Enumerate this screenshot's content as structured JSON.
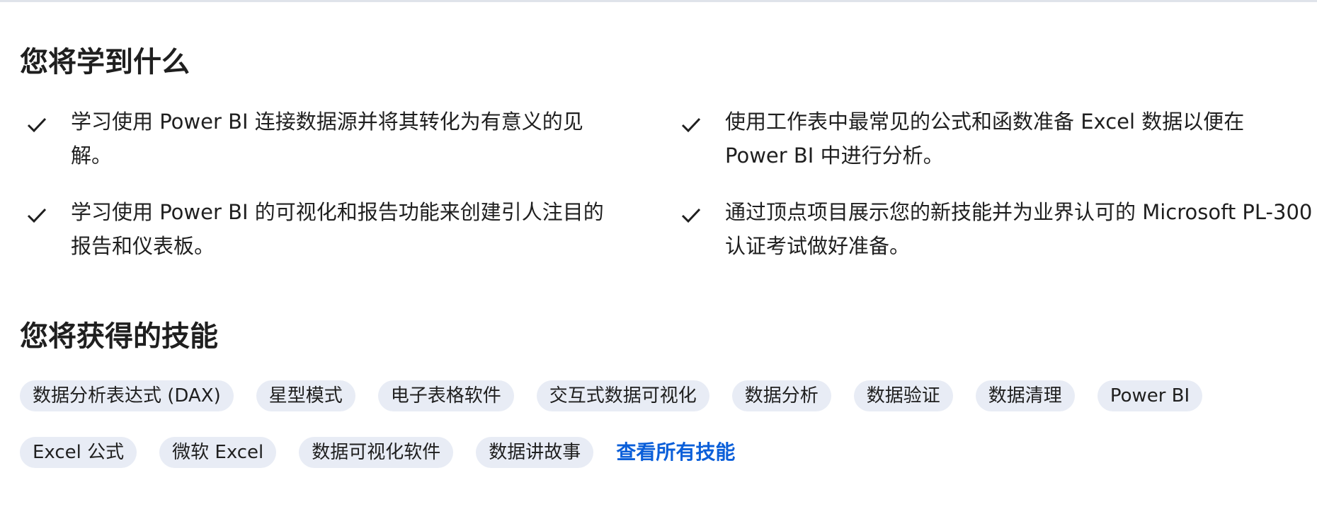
{
  "learn": {
    "title": "您将学到什么",
    "items": [
      "学习使用 Power BI 连接数据源并将其转化为有意义的见解。",
      "使用工作表中最常见的公式和函数准备 Excel 数据以便在 Power BI 中进行分析。",
      "学习使用 Power BI 的可视化和报告功能来创建引人注目的报告和仪表板。",
      "通过顶点项目展示您的新技能并为业界认可的 Microsoft PL-300 认证考试做好准备。"
    ]
  },
  "skills": {
    "title": "您将获得的技能",
    "row1": [
      "数据分析表达式 (DAX)",
      "星型模式",
      "电子表格软件",
      "交互式数据可视化",
      "数据分析",
      "数据验证",
      "数据清理",
      "Power BI"
    ],
    "row2": [
      "Excel 公式",
      "微软 Excel",
      "数据可视化软件",
      "数据讲故事"
    ],
    "view_all_label": "查看所有技能"
  },
  "colors": {
    "text": "#1f1f1f",
    "chip_bg": "#e8ecf5",
    "link": "#0b5fd9"
  },
  "icons": {
    "check": "check-icon"
  }
}
